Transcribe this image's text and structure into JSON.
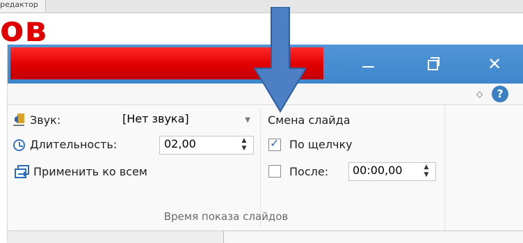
{
  "background_strip": {
    "tab_label": "редактор"
  },
  "heading_text": "ов",
  "window_controls": {
    "minimize_icon": "minimize-icon",
    "restore_icon": "restore-icon",
    "close_icon": "close-icon"
  },
  "ribbon_head": {
    "collapse_icon": "chevron-up-icon",
    "help_label": "?"
  },
  "timing": {
    "sound_label": "Звук:",
    "sound_value": "[Нет звука]",
    "duration_label": "Длительность:",
    "duration_value": "02,00",
    "apply_all_label": "Применить ко всем",
    "advance_title": "Смена слайда",
    "on_click_label": "По щелчку",
    "on_click_checked": true,
    "after_label": "После:",
    "after_checked": false,
    "after_value": "00:00,00",
    "group_label": "Время показа слайдов"
  },
  "colors": {
    "accent_red": "#e00000",
    "titlebar_blue": "#3f86cc",
    "arrow_blue": "#4d7fc5"
  }
}
